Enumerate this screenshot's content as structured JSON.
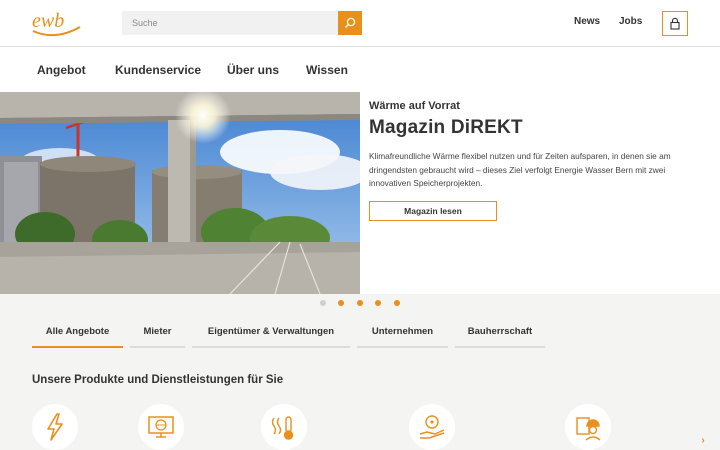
{
  "header": {
    "logo_text": "ewb",
    "search_placeholder": "Suche",
    "links": [
      "News",
      "Jobs"
    ]
  },
  "main_nav": [
    "Angebot",
    "Kundenservice",
    "Über uns",
    "Wissen"
  ],
  "hero": {
    "kicker": "Wärme auf Vorrat",
    "title": "Magazin DiREKT",
    "body": "Klimafreundliche Wärme flexibel nutzen und für Zeiten aufsparen, in denen sie am dringendsten gebraucht wird – dieses Ziel verfolgt Energie Wasser Bern mit zwei innovativen Speicherprojekten.",
    "cta": "Magazin lesen"
  },
  "carousel": {
    "slides": 5,
    "active_index": 0
  },
  "audience_tabs": [
    "Alle Angebote",
    "Mieter",
    "Eigentümer & Verwaltungen",
    "Unternehmen",
    "Bauherrschaft"
  ],
  "active_tab_index": 0,
  "services": {
    "title": "Unsere Produkte und Dienstleistungen für Sie",
    "icons": [
      "lightning-icon",
      "monitor-globe-icon",
      "heat-thermometer-icon",
      "piggy-hand-icon",
      "worker-helmet-icon"
    ]
  },
  "colors": {
    "accent": "#e8901b",
    "text": "#333333",
    "section_bg": "#f4f4f2"
  }
}
